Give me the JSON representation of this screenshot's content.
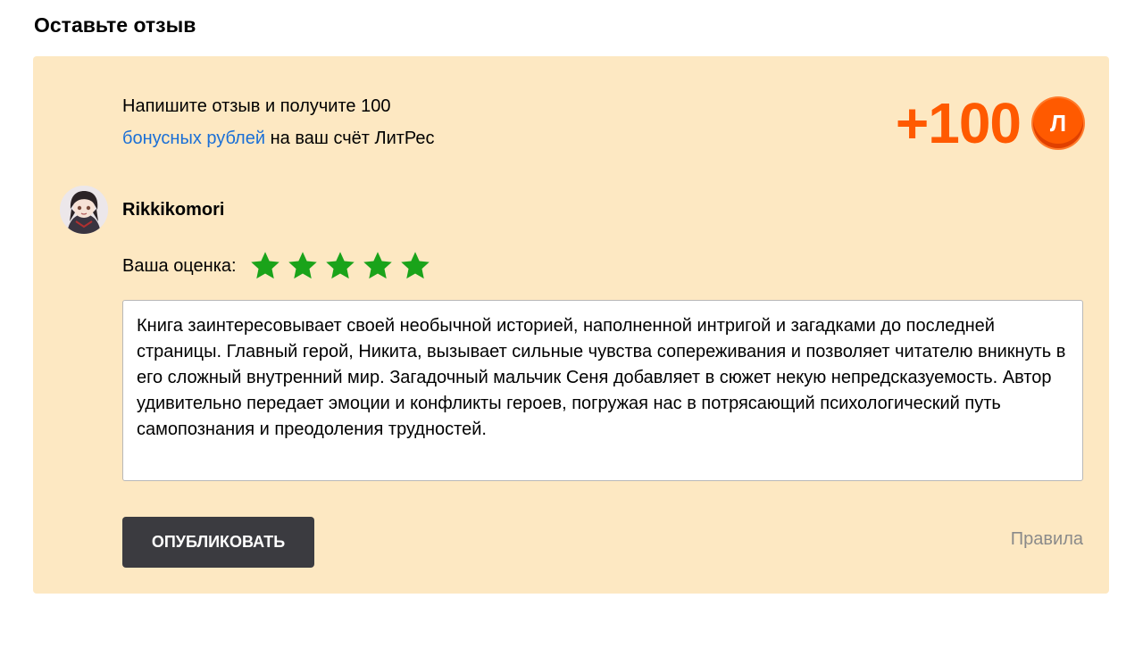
{
  "header": {
    "title": "Оставьте отзыв"
  },
  "promo": {
    "text_line1": "Напишите отзыв и получите 100",
    "link_text": "бонусных рублей",
    "text_after_link": " на ваш счёт ЛитРес",
    "bonus_amount": "+100",
    "coin_letter": "Л",
    "accent_color": "#ff5a00"
  },
  "user": {
    "name": "Rikkikomori",
    "avatar_icon": "user-avatar-icon"
  },
  "rating": {
    "label": "Ваша оценка:",
    "value": 5,
    "max": 5,
    "star_color": "#1aa31a"
  },
  "review": {
    "text": "Книга заинтересовывает своей необычной историей, наполненной интригой и загадками до последней страницы. Главный герой, Никита, вызывает сильные чувства сопереживания и позволяет читателю вникнуть в его сложный внутренний мир. Загадочный мальчик Сеня добавляет в сюжет некую непредсказуемость. Автор удивительно передает эмоции и конфликты героев, погружая нас в потрясающий психологический путь самопознания и преодоления трудностей."
  },
  "actions": {
    "publish_label": "ОПУБЛИКОВАТЬ",
    "rules_label": "Правила"
  }
}
